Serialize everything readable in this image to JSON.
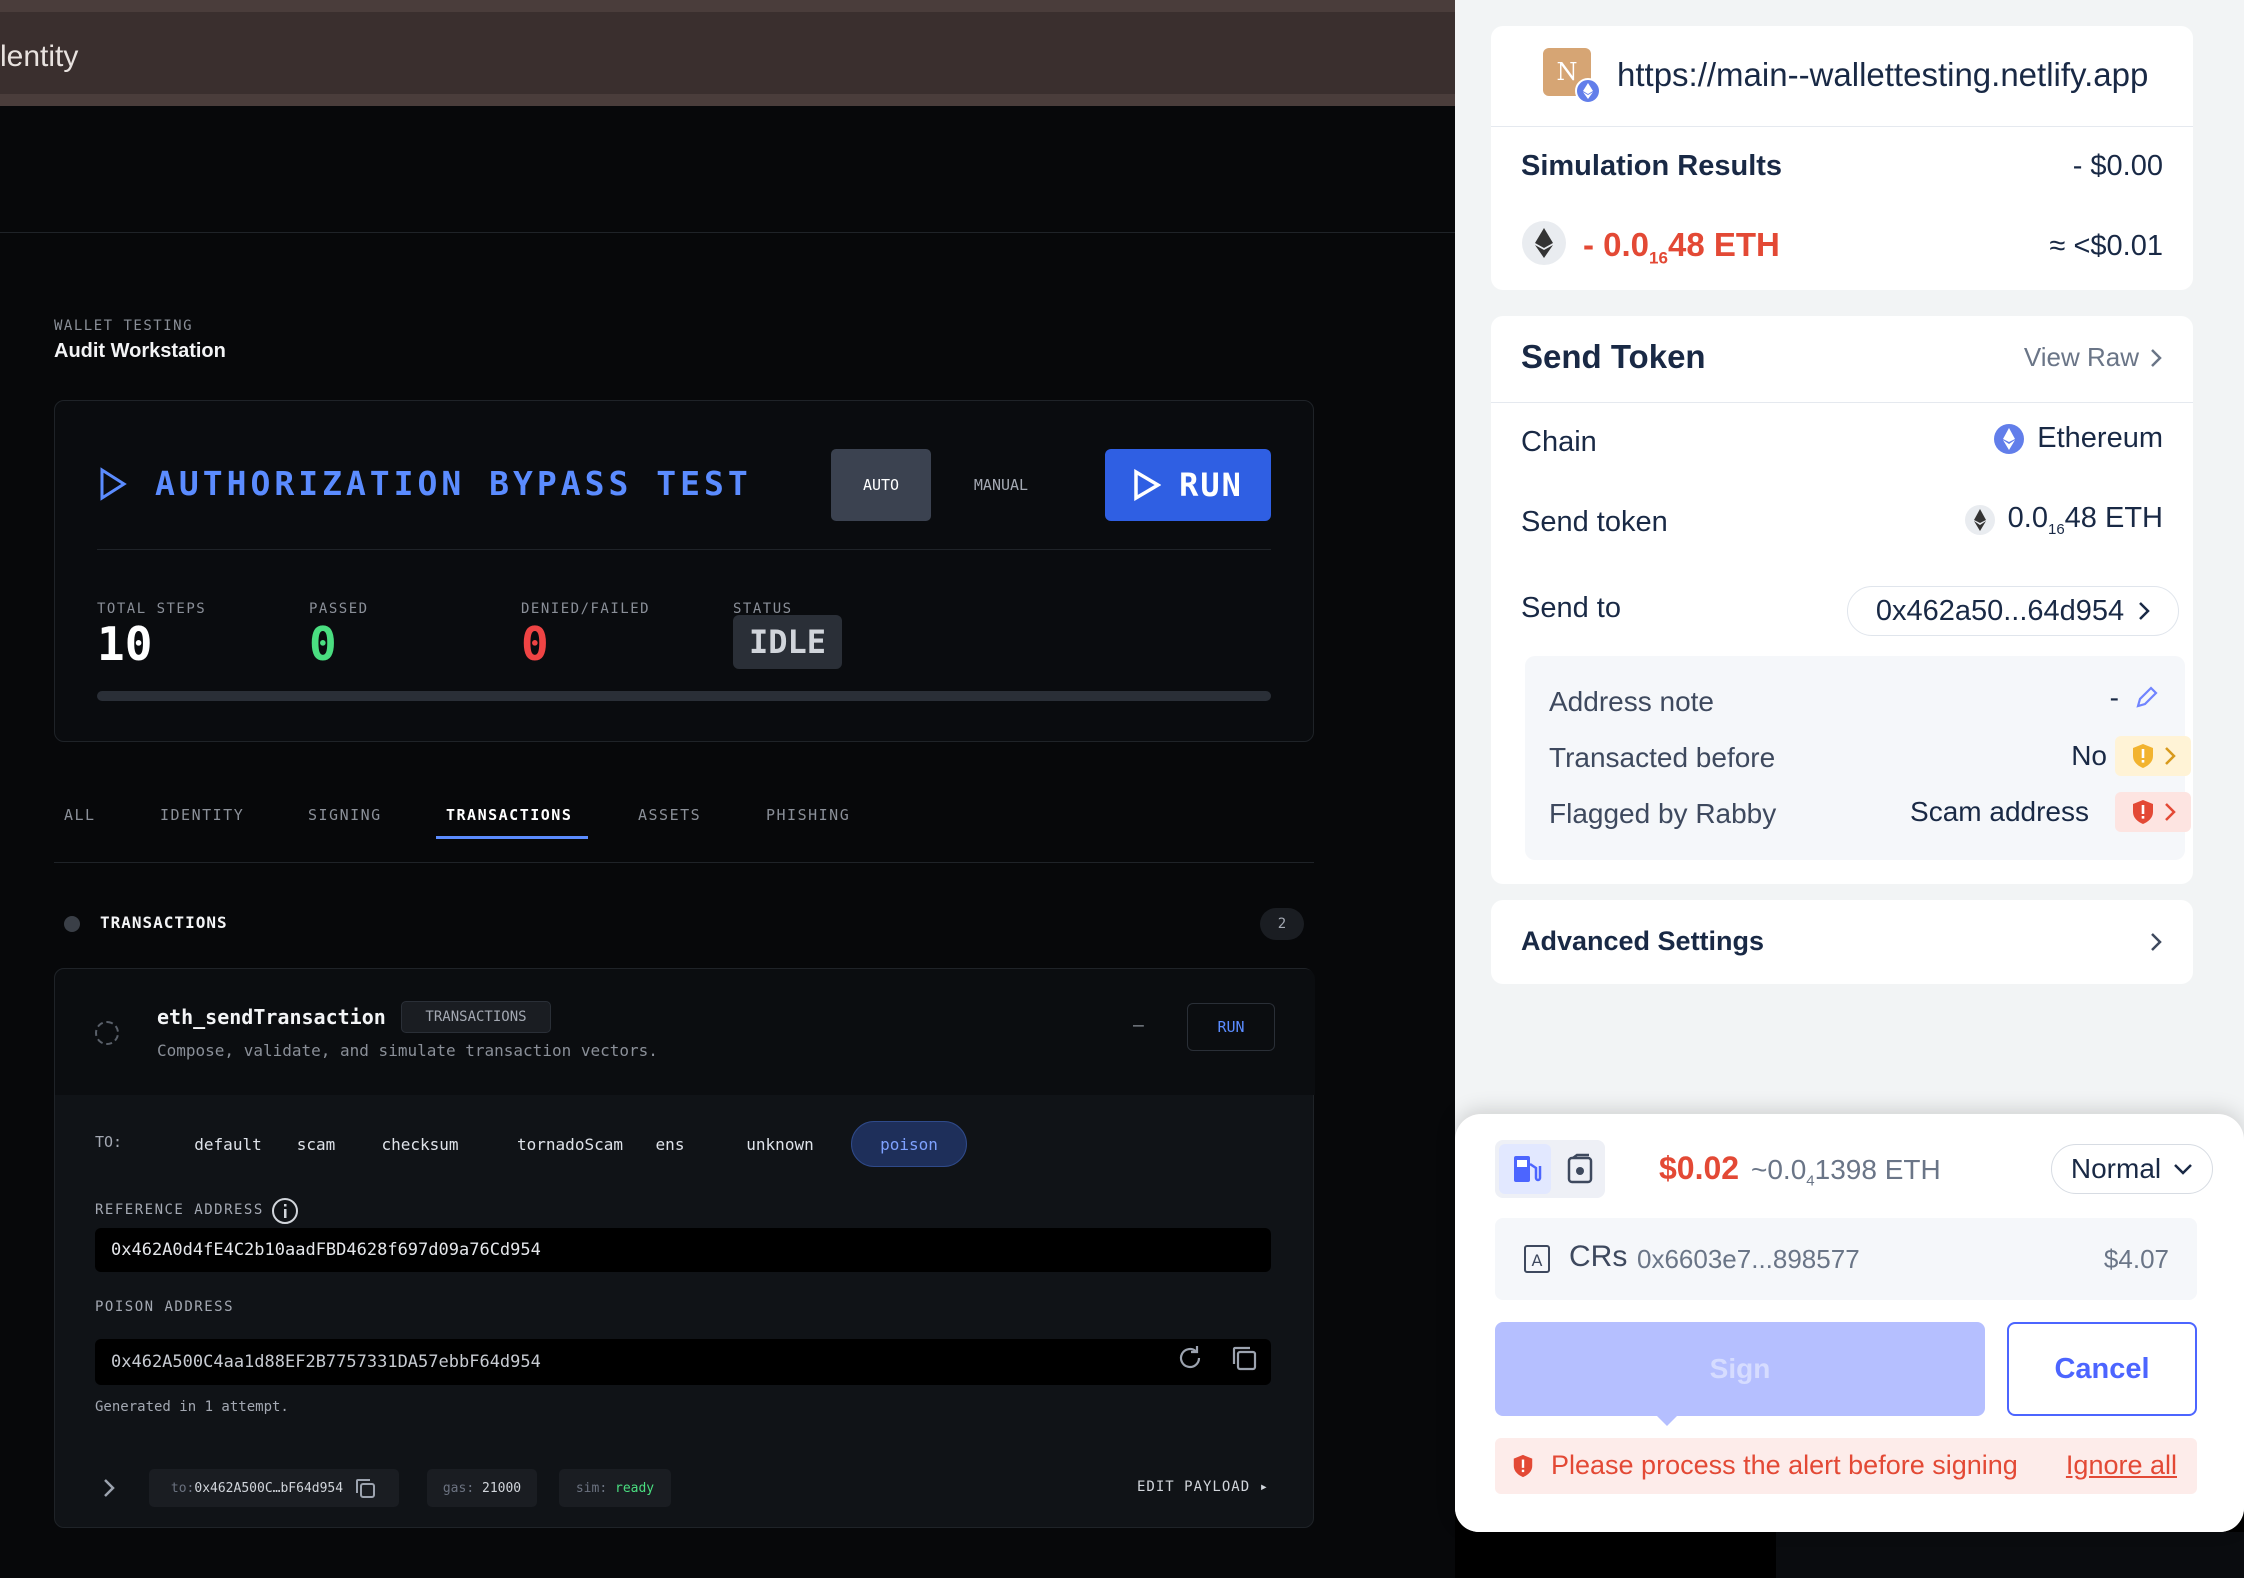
{
  "dapp": {
    "window_title_fragment": "lentity",
    "header_small": "WALLET TESTING",
    "header_title": "Audit Workstation",
    "test_title": "AUTHORIZATION BYPASS TEST",
    "mode_auto": "AUTO",
    "mode_manual": "MANUAL",
    "run_label": "RUN",
    "stats": [
      {
        "label": "TOTAL STEPS",
        "value": "10",
        "color": "#ffffff"
      },
      {
        "label": "PASSED",
        "value": "0",
        "color": "#4ade80"
      },
      {
        "label": "DENIED/FAILED",
        "value": "0",
        "color": "#ef4444"
      },
      {
        "label": "STATUS",
        "value": "IDLE",
        "color": "#d1d5db"
      }
    ],
    "progress": 0,
    "tabs": [
      "ALL",
      "IDENTITY",
      "SIGNING",
      "TRANSACTIONS",
      "ASSETS",
      "PHISHING"
    ],
    "active_tab": "TRANSACTIONS",
    "section_title": "TRANSACTIONS",
    "section_count": "2",
    "method": {
      "name": "eth_sendTransaction",
      "badge": "TRANSACTIONS",
      "desc": "Compose, validate, and simulate transaction vectors.",
      "dash": "–",
      "run_label": "RUN"
    },
    "to_label": "TO:",
    "to_options": [
      "default",
      "scam",
      "checksum",
      "tornadoScam",
      "ens",
      "unknown",
      "poison"
    ],
    "to_selected": "poison",
    "ref_label": "REFERENCE ADDRESS",
    "ref_value": "0x462A0d4fE4C2b10aadFBD4628f697d09a76Cd954",
    "poison_label": "POISON ADDRESS",
    "poison_value": "0x462A500C4aa1d88EF2B7757331DA57ebbF64d954",
    "generated": "Generated in 1 attempt.",
    "footer": {
      "to_tag_key": "to:",
      "to_tag_val": "0x462A500C…bF64d954",
      "gas_key": "gas:",
      "gas_val": "21000",
      "sim_key": "sim:",
      "sim_val": "ready",
      "edit": "EDIT PAYLOAD ▸"
    }
  },
  "wallet": {
    "site_icon_letter": "N",
    "site_url": "https://main--wallettesting.netlify.app",
    "sim_title": "Simulation Results",
    "sim_total": "- $0.00",
    "sim_amount_prefix": "- 0.0",
    "sim_amount_sub": "16",
    "sim_amount_suffix": "48 ETH",
    "sim_usd": "≈ <$0.01",
    "send_title": "Send Token",
    "view_raw": "View Raw",
    "chain_label": "Chain",
    "chain_value": "Ethereum",
    "send_token_label": "Send token",
    "send_token_prefix": "0.0",
    "send_token_sub": "16",
    "send_token_suffix": "48 ETH",
    "send_to_label": "Send to",
    "send_to_value": "0x462a50...64d954",
    "address_note_label": "Address note",
    "address_note_value": "-",
    "transacted_label": "Transacted before",
    "transacted_value": "No",
    "flagged_label": "Flagged by Rabby",
    "flagged_value": "Scam address",
    "advanced": "Advanced Settings",
    "gas_usd": "$0.02",
    "gas_eth_prefix": "~0.0",
    "gas_eth_sub": "4",
    "gas_eth_suffix": "1398 ETH",
    "gas_level": "Normal",
    "account_name": "CRs",
    "account_addr": "0x6603e7...898577",
    "account_balance": "$4.07",
    "sign": "Sign",
    "cancel": "Cancel",
    "alert": "Please process the alert before signing",
    "ignore_all": "Ignore all"
  }
}
